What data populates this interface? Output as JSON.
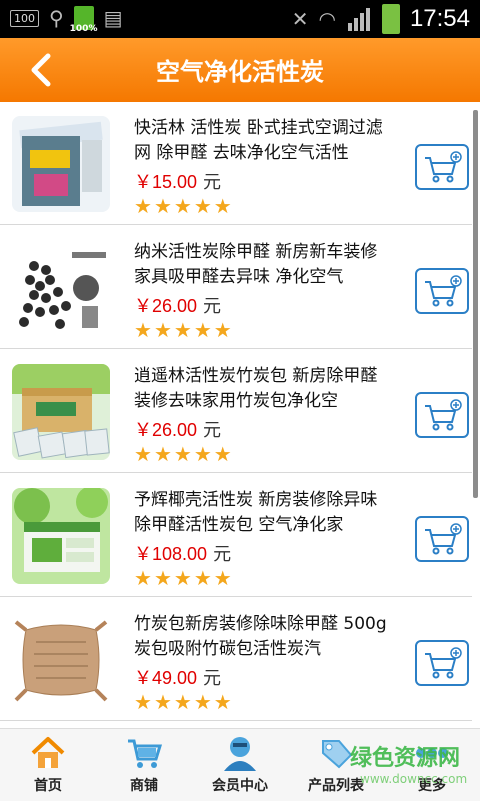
{
  "status_bar": {
    "left_box": "100",
    "battery_label": "100%",
    "time": "17:54"
  },
  "header": {
    "title": "空气净化活性炭"
  },
  "products": [
    {
      "name": "快活林 活性炭 卧式挂式空调过滤网 除甲醛 去味净化空气活性",
      "price": "￥15.00",
      "unit": "元",
      "rating": 5
    },
    {
      "name": "纳米活性炭除甲醛 新房新车装修家具吸甲醛去异味 净化空气",
      "price": "￥26.00",
      "unit": "元",
      "rating": 5
    },
    {
      "name": "逍遥林活性炭竹炭包 新房除甲醛装修去味家用竹炭包净化空",
      "price": "￥26.00",
      "unit": "元",
      "rating": 5
    },
    {
      "name": "予辉椰壳活性炭 新房装修除异味除甲醛活性炭包 空气净化家",
      "price": "￥108.00",
      "unit": "元",
      "rating": 5
    },
    {
      "name": "竹炭包新房装修除味除甲醛 500g炭包吸附竹碳包活性炭汽",
      "price": "￥49.00",
      "unit": "元",
      "rating": 5
    }
  ],
  "bottom_nav": [
    {
      "label": "首页",
      "icon": "home-icon"
    },
    {
      "label": "商铺",
      "icon": "cart-icon"
    },
    {
      "label": "会员中心",
      "icon": "member-icon"
    },
    {
      "label": "产品列表",
      "icon": "tag-icon"
    },
    {
      "label": "更多",
      "icon": "more-icon"
    }
  ],
  "watermark": {
    "text": "绿色资源网",
    "url": "www.downcc.com"
  },
  "colors": {
    "header_orange": "#f57800",
    "price_red": "#e00000",
    "star_gold": "#f4a71d",
    "cart_blue": "#2b7fc6"
  }
}
